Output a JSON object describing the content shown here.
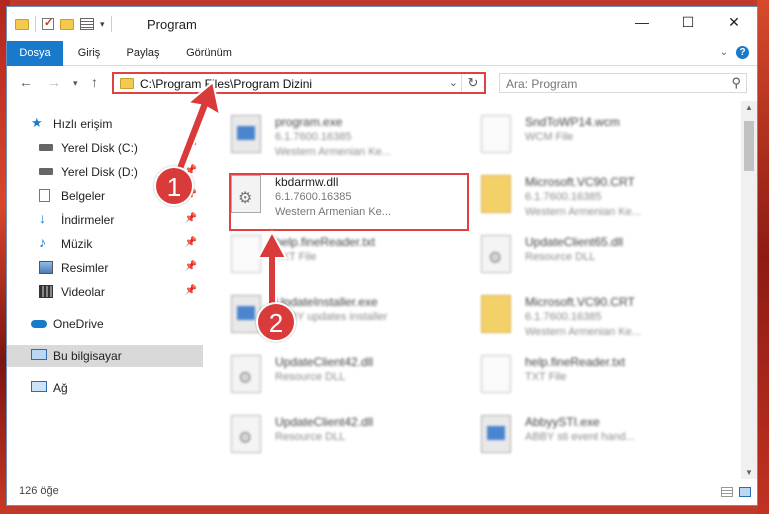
{
  "window": {
    "title": "Program"
  },
  "ribbon": {
    "tabs": [
      "Dosya",
      "Giriş",
      "Paylaş",
      "Görünüm"
    ]
  },
  "address": {
    "path": "C:\\Program Files\\Program Dizini"
  },
  "search": {
    "placeholder": "Ara: Program"
  },
  "sidebar": {
    "items": [
      {
        "label": "Hızlı erişim",
        "icon": "star-icon"
      },
      {
        "label": "Yerel Disk (C:)",
        "icon": "drive-icon"
      },
      {
        "label": "Yerel Disk (D:)",
        "icon": "drive-icon"
      },
      {
        "label": "Belgeler",
        "icon": "documents-icon"
      },
      {
        "label": "İndirmeler",
        "icon": "download-icon"
      },
      {
        "label": "Müzik",
        "icon": "music-icon"
      },
      {
        "label": "Resimler",
        "icon": "pictures-icon"
      },
      {
        "label": "Videolar",
        "icon": "video-icon"
      },
      {
        "label": "OneDrive",
        "icon": "cloud-icon"
      },
      {
        "label": "Bu bilgisayar",
        "icon": "computer-icon"
      },
      {
        "label": "Ağ",
        "icon": "network-icon"
      }
    ]
  },
  "files": [
    {
      "name": "program.exe",
      "line1": "6.1.7600.16385",
      "line2": "Western Armenian Ke..."
    },
    {
      "name": "SndToWP14.wcm",
      "line1": "WCM File",
      "line2": ""
    },
    {
      "name": "kbdarmw.dll",
      "line1": "6.1.7600.16385",
      "line2": "Western Armenian Ke..."
    },
    {
      "name": "Microsoft.VC90.CRT",
      "line1": "6.1.7600.16385",
      "line2": "Western Armenian Ke..."
    },
    {
      "name": "help.fineReader.txt",
      "line1": "TXT File",
      "line2": ""
    },
    {
      "name": "UpdateClient65.dll",
      "line1": "Resource DLL",
      "line2": ""
    },
    {
      "name": "UpdateInstaller.exe",
      "line1": "ABBY updates installer",
      "line2": ""
    },
    {
      "name": "Microsoft.VC90.CRT",
      "line1": "6.1.7600.16385",
      "line2": "Western Armenian Ke..."
    },
    {
      "name": "UpdateClient42.dll",
      "line1": "Resource DLL",
      "line2": ""
    },
    {
      "name": "help.fineReader.txt",
      "line1": "TXT File",
      "line2": ""
    },
    {
      "name": "UpdateClient42.dll",
      "line1": "Resource DLL",
      "line2": ""
    },
    {
      "name": "AbbyySTI.exe",
      "line1": "ABBY sti event hand...",
      "line2": ""
    }
  ],
  "status": {
    "count": "126 öğe"
  },
  "annotations": {
    "step1": "1",
    "step2": "2"
  },
  "colors": {
    "accent": "#1979ca",
    "highlight": "#e04141",
    "callout": "#d93b3b"
  }
}
